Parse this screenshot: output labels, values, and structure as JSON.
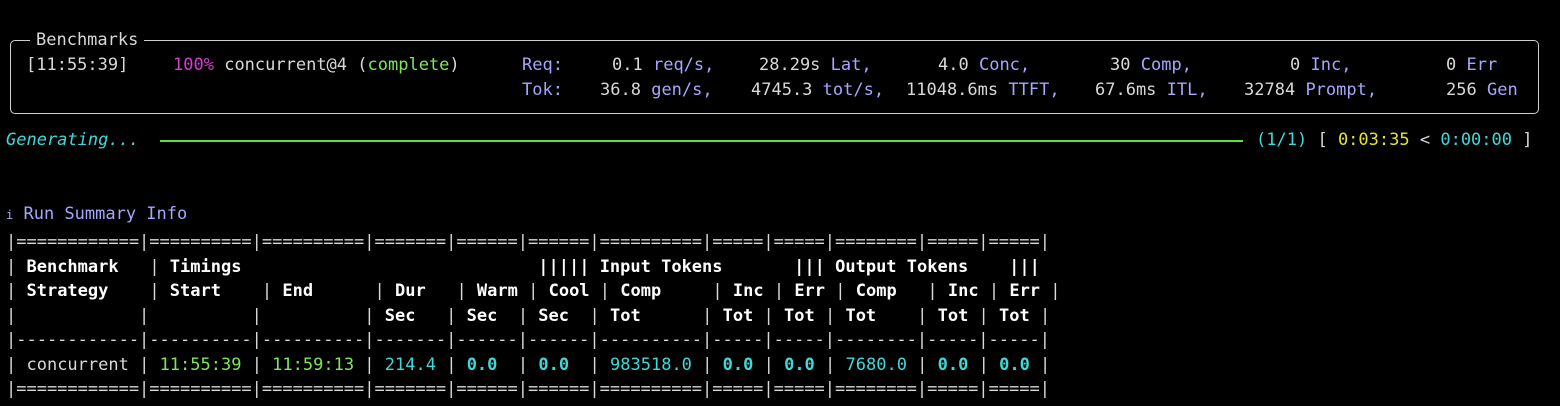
{
  "panel": {
    "title": "Benchmarks",
    "timestamp": "[11:55:39]",
    "percent": "100%",
    "strategy": "concurrent@4",
    "paren_open": "(",
    "status": "complete",
    "paren_close": ")",
    "req_label": "Req:",
    "tok_label": "Tok:",
    "req": {
      "rate_val": "0.1",
      "rate_unit": "req/s,",
      "lat_val": "28.29s",
      "lat_unit": "Lat,",
      "conc_val": "4.0",
      "conc_unit": "Conc,",
      "comp_val": "30",
      "comp_unit": "Comp,",
      "inc_val": "0",
      "inc_unit": "Inc,",
      "err_val": "0",
      "err_unit": "Err"
    },
    "tok": {
      "gen_val": "36.8",
      "gen_unit": "gen/s,",
      "tot_val": "4745.3",
      "tot_unit": "tot/s,",
      "ttft_val": "11048.6ms",
      "ttft_unit": "TTFT,",
      "itl_val": "67.6ms",
      "itl_unit": "ITL,",
      "prompt_val": "32784",
      "prompt_unit": "Prompt,",
      "gen2_val": "256",
      "gen2_unit": "Gen"
    }
  },
  "progress": {
    "label": "Generating...",
    "count": "(1/1)",
    "bracket_open": "[",
    "elapsed": "0:03:35",
    "lt": "<",
    "remaining": "0:00:00",
    "bracket_close": "]",
    "fraction": 1.0
  },
  "summary": {
    "icon": "i",
    "title": "Run Summary Info",
    "sep_double": "|============|==========|==========|=======|======|======|==========|=====|=====|========|=====|=====|",
    "sep_single": "|------------|----------|----------|-------|------|------|----------|-----|-----|--------|-----|-----|",
    "header_rows": [
      [
        "| ",
        "Benchmark  ",
        " | ",
        "Timings",
        "                             ",
        "||||| ",
        "Input Tokens",
        "       ",
        "||| ",
        "Output Tokens",
        "    ",
        "|||"
      ],
      [
        "| ",
        "Strategy   ",
        " | ",
        "Start    ",
        "| ",
        "End      ",
        "| ",
        "Dur   ",
        "| ",
        "Warm ",
        "| ",
        "Cool ",
        "| ",
        "Comp     ",
        "| ",
        "Inc ",
        "| ",
        "Err ",
        "| ",
        "Comp   ",
        "| ",
        "Inc ",
        "| ",
        "Err ",
        "|"
      ],
      [
        "| ",
        "Sec   ",
        "| ",
        "Sec  ",
        "| ",
        "Sec  ",
        "| ",
        "Tot      ",
        "| ",
        "Tot ",
        "| ",
        "Tot ",
        "| ",
        "Tot    ",
        "| ",
        "Tot ",
        "| ",
        "Tot ",
        "|"
      ]
    ],
    "row": {
      "strategy": "concurrent",
      "start": "11:55:39",
      "end": "11:59:13",
      "dur": "214.4",
      "warm": "0.0",
      "cool": "0.0",
      "in_comp": "983518.0",
      "in_inc": "0.0",
      "in_err": "0.0",
      "out_comp": "7680.0",
      "out_inc": "0.0",
      "out_err": "0.0"
    }
  }
}
